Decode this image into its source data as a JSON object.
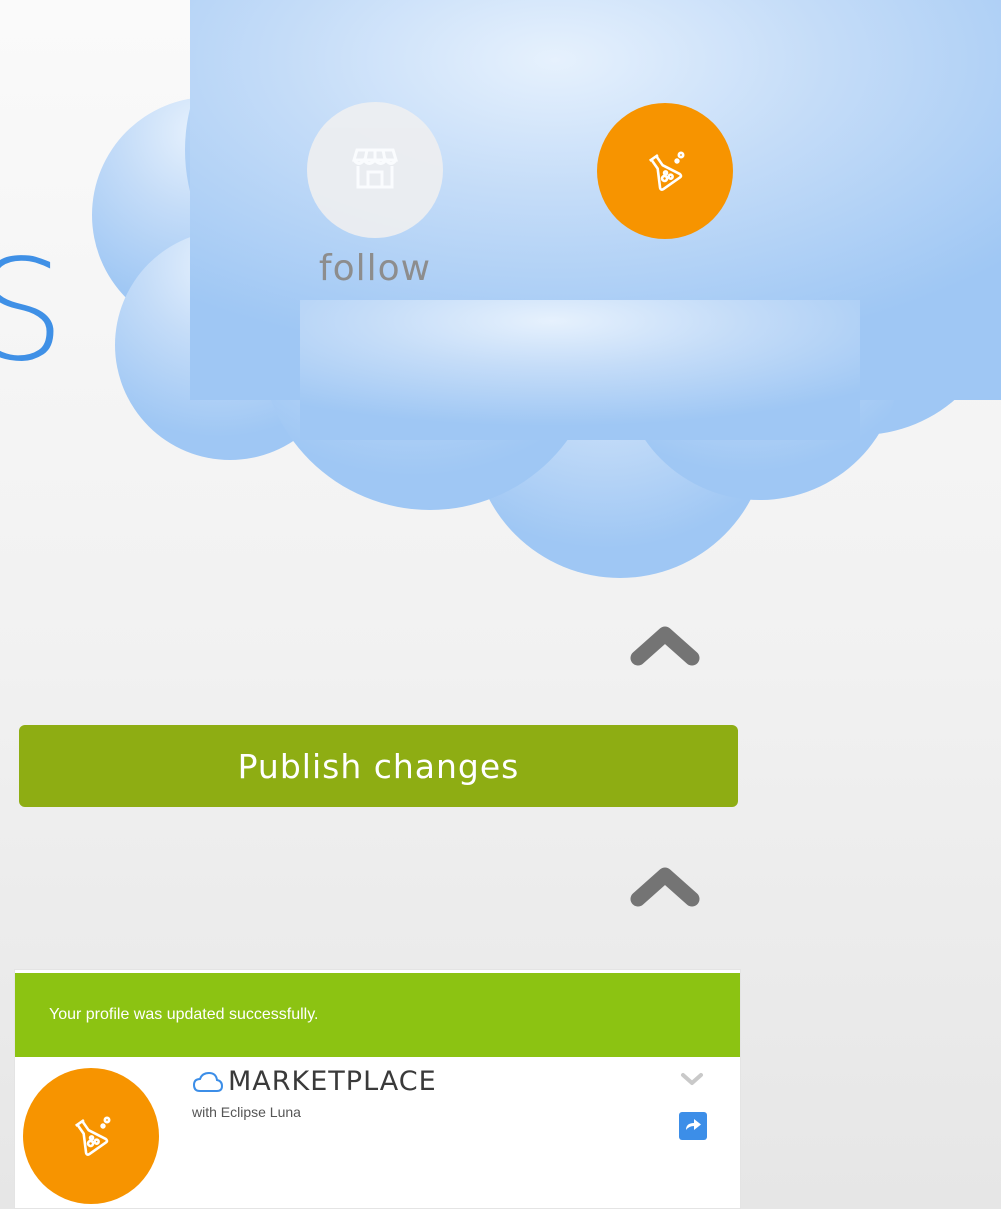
{
  "partial_heading": "S",
  "profile_actions": {
    "follow_label": "follow",
    "follow_icon": "store-icon",
    "avatar_icon": "flask-icon"
  },
  "publish_button": {
    "label": "Publish changes",
    "color": "#8ead13"
  },
  "notification": {
    "message": "Your profile was updated successfully.",
    "color": "#8cc312"
  },
  "card": {
    "title": "MARKETPLACE",
    "subtitle": "with Eclipse Luna",
    "avatar_color": "#f79400",
    "share_icon": "share-icon",
    "dropdown_icon": "chevron-down-icon"
  },
  "colors": {
    "accent_orange": "#f79400",
    "cloud_blue": "#a6cdf7",
    "share_blue": "#3c8ee8"
  }
}
